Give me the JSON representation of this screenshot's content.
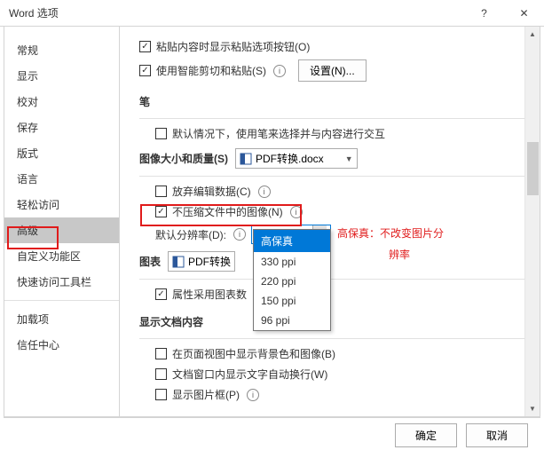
{
  "window": {
    "title": "Word 选项"
  },
  "sidebar": {
    "items": [
      "常规",
      "显示",
      "校对",
      "保存",
      "版式",
      "语言",
      "轻松访问",
      "高级",
      "自定义功能区",
      "快速访问工具栏",
      "加载项",
      "信任中心"
    ],
    "selected": "高级"
  },
  "content": {
    "paste_opts": "粘贴内容时显示粘贴选项按钮(O)",
    "smart_cut": "使用智能剪切和粘贴(S)",
    "settings_btn": "设置(N)...",
    "pen_section": "笔",
    "pen_default": "默认情况下，使用笔来选择并与内容进行交互",
    "img_section": "图像大小和质量(S)",
    "file_name": "PDF转换.docx",
    "discard_edit": "放弃编辑数据(C)",
    "no_compress": "不压缩文件中的图像(N)",
    "default_res": "默认分辨率(D):",
    "res_value": "高保真",
    "res_options": [
      "高保真",
      "330 ppi",
      "220 ppi",
      "150 ppi",
      "96 ppi"
    ],
    "chart_section": "图表",
    "chart_file": "PDF转换",
    "chart_props": "属性采用图表数",
    "doc_content_section": "显示文档内容",
    "show_bg": "在页面视图中显示背景色和图像(B)",
    "wrap_text": "文档窗口内显示文字自动换行(W)",
    "show_frame": "显示图片框(P)"
  },
  "annotation": {
    "line1": "高保真：不改变图片分",
    "line2": "辨率"
  },
  "footer": {
    "ok": "确定",
    "cancel": "取消"
  }
}
